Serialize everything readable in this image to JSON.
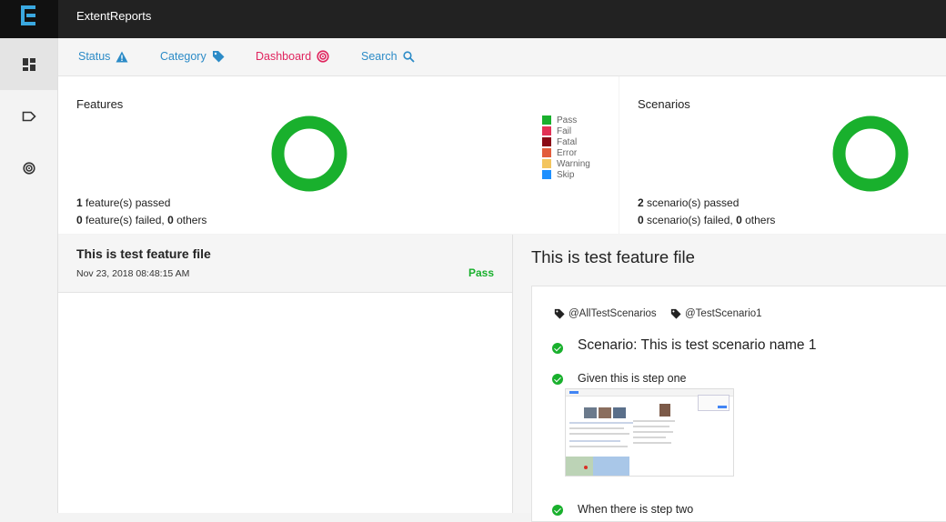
{
  "app": {
    "title": "ExtentReports"
  },
  "sidebar": {
    "items": [
      "dashboard-grid-icon",
      "tag-label-icon",
      "target-icon"
    ]
  },
  "nav": {
    "status": "Status",
    "category": "Category",
    "dashboard": "Dashboard",
    "search": "Search"
  },
  "features": {
    "title": "Features",
    "passed_count": "1",
    "passed_label": " feature(s) passed",
    "failed_count": "0",
    "failed_label": " feature(s) failed, ",
    "others_count": "0",
    "others_label": " others"
  },
  "scenarios": {
    "title": "Scenarios",
    "passed_count": "2",
    "passed_label": " scenario(s) passed",
    "failed_count": "0",
    "failed_label": " scenario(s) failed, ",
    "others_count": "0",
    "others_label": " others"
  },
  "legend": [
    {
      "label": "Pass",
      "color": "#19b02d"
    },
    {
      "label": "Fail",
      "color": "#e23155"
    },
    {
      "label": "Fatal",
      "color": "#8b0a16"
    },
    {
      "label": "Error",
      "color": "#e25c3c"
    },
    {
      "label": "Warning",
      "color": "#f3c55e"
    },
    {
      "label": "Skip",
      "color": "#1e90ff"
    }
  ],
  "colors": {
    "pass": "#19b02d",
    "nav_blue": "#2c8bc7",
    "nav_pink": "#e0245e"
  },
  "test_list": [
    {
      "name": "This is test feature file",
      "time": "Nov 23, 2018 08:48:15 AM",
      "status": "Pass"
    }
  ],
  "detail": {
    "title": "This is test feature file",
    "tags": [
      "@AllTestScenarios",
      "@TestScenario1"
    ],
    "scenario": "Scenario: This is test scenario name 1",
    "steps": [
      "Given this is step one",
      "When there is step two"
    ]
  }
}
